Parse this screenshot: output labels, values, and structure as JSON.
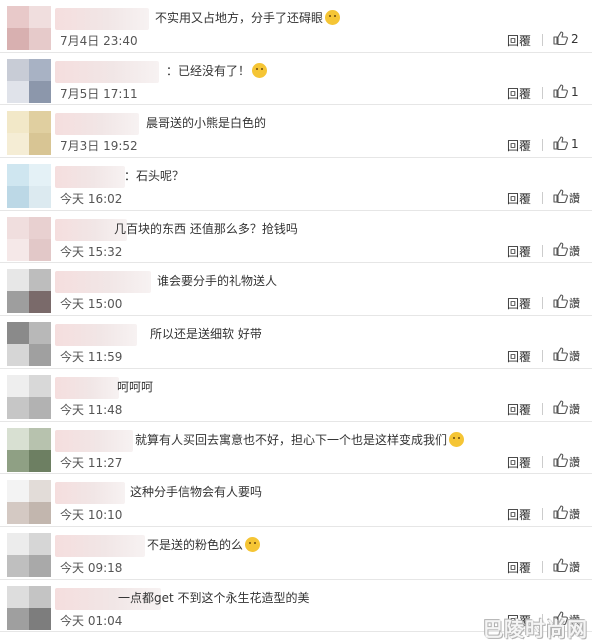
{
  "comments": [
    {
      "text": "不实用又占地方，分手了还碍眼",
      "emoji": "grinning-emoji",
      "time": "7月4日 23:40",
      "reply": "回覆",
      "likes": "2",
      "zan": ""
    },
    {
      "text": "：已经没有了！",
      "emoji": "doge-emoji",
      "time": "7月5日 17:11",
      "reply": "回覆",
      "likes": "1",
      "zan": ""
    },
    {
      "text": "晨哥送的小熊是白色的",
      "emoji": "",
      "time": "7月3日 19:52",
      "reply": "回覆",
      "likes": "1",
      "zan": ""
    },
    {
      "text": "：石头呢？",
      "emoji": "",
      "time": "今天 16:02",
      "reply": "回覆",
      "likes": "",
      "zan": "讚"
    },
    {
      "text": "几百块的东西 还值那么多？抢钱吗",
      "emoji": "",
      "time": "今天 15:32",
      "reply": "回覆",
      "likes": "",
      "zan": "讚"
    },
    {
      "text": "谁会要分手的礼物送人",
      "emoji": "",
      "time": "今天 15:00",
      "reply": "回覆",
      "likes": "",
      "zan": "讚"
    },
    {
      "text": "所以还是送细软  好带",
      "emoji": "",
      "time": "今天 11:59",
      "reply": "回覆",
      "likes": "",
      "zan": "讚"
    },
    {
      "text": "呵呵呵",
      "emoji": "",
      "time": "今天 11:48",
      "reply": "回覆",
      "likes": "",
      "zan": "讚"
    },
    {
      "text": "就算有人买回去寓意也不好，担心下一个也是这样变成我们",
      "emoji": "shy-emoji",
      "time": "今天 11:27",
      "reply": "回覆",
      "likes": "",
      "zan": "讚"
    },
    {
      "text": "这种分手信物会有人要吗",
      "emoji": "",
      "time": "今天 10:10",
      "reply": "回覆",
      "likes": "",
      "zan": "讚"
    },
    {
      "text": "不是送的粉色的么",
      "emoji": "surprised-emoji",
      "time": "今天 09:18",
      "reply": "回覆",
      "likes": "",
      "zan": "讚"
    },
    {
      "text": "一点都get 不到这个永生花造型的美",
      "emoji": "",
      "time": "今天 01:04",
      "reply": "回覆",
      "likes": "",
      "zan": "讚"
    }
  ],
  "watermark": "巴陵时尚网",
  "colors": {
    "text": "#333333",
    "time": "#555555",
    "divider": "#e6e6e6",
    "emoji": "#f5c535"
  }
}
